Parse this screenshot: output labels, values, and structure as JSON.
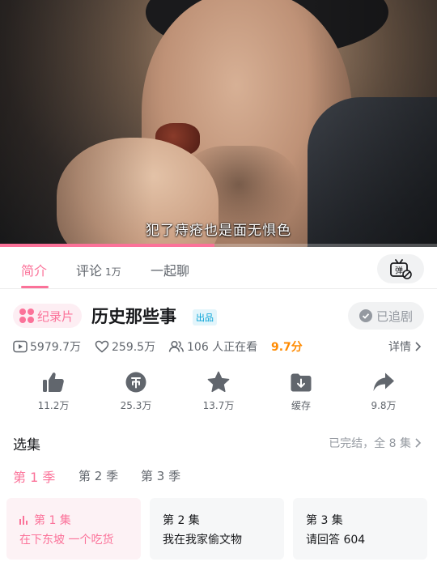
{
  "video": {
    "subtitle": "犯了痔疮也是面无惧色",
    "progress_fraction": 0.49
  },
  "tabs": [
    {
      "label": "简介",
      "active": true
    },
    {
      "label": "评论",
      "count": "1万"
    },
    {
      "label": "一起聊"
    }
  ],
  "danmaku_toggle": {
    "icon": "danmaku-off-icon",
    "text": "弹"
  },
  "show": {
    "genre": "纪录片",
    "title": "历史那些事",
    "producer_tag": "出品",
    "follow_label": "已追剧"
  },
  "stats": {
    "plays": "5979.7万",
    "likes": "259.5万",
    "watching": "106 人正在看",
    "score": "9.7分",
    "details_label": "详情"
  },
  "actions": [
    {
      "icon": "thumbs-up-icon",
      "label": "11.2万"
    },
    {
      "icon": "coin-icon",
      "label": "25.3万"
    },
    {
      "icon": "star-icon",
      "label": "13.7万"
    },
    {
      "icon": "download-icon",
      "label": "缓存"
    },
    {
      "icon": "share-icon",
      "label": "9.8万"
    }
  ],
  "episodes_section": {
    "title": "选集",
    "status": "已完结，全 8 集",
    "seasons": [
      "第 1 季",
      "第 2 季",
      "第 3 季"
    ],
    "active_season": 0,
    "episodes": [
      {
        "num": "第 1 集",
        "name": "在下东坡 一个吃货",
        "active": true
      },
      {
        "num": "第 2 集",
        "name": "我在我家偷文物"
      },
      {
        "num": "第 3 集",
        "name": "请回答 604"
      }
    ]
  },
  "colors": {
    "accent": "#fb7299",
    "score": "#ff8a00",
    "producer": "#00a1d6"
  }
}
